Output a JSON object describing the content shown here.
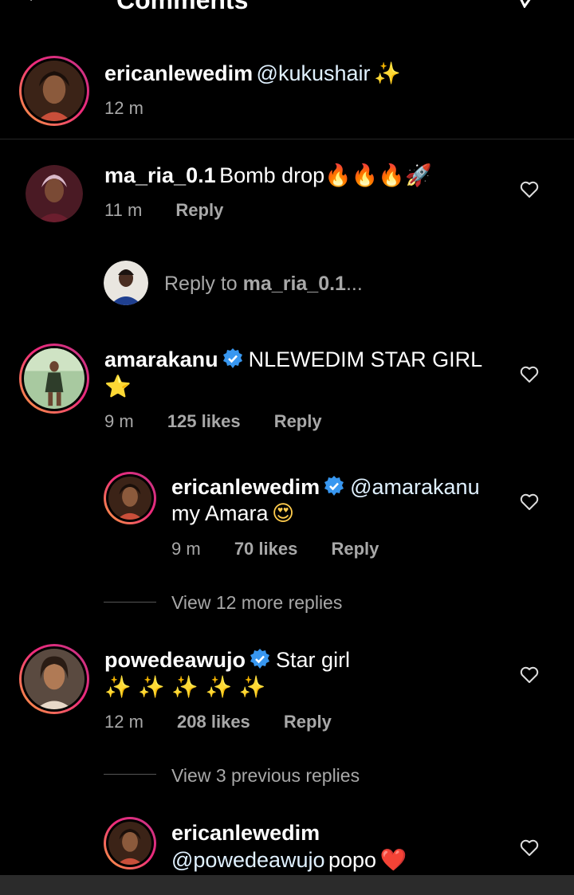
{
  "header": {
    "title": "Comments"
  },
  "caption": {
    "username": "ericanlewedim",
    "mention": "@kukushair",
    "emoji": "✨",
    "time": "12 m"
  },
  "comments": [
    {
      "username": "ma_ria_0.1",
      "text": "Bomb drop",
      "emojis": "🔥🔥🔥🚀",
      "time": "11 m",
      "reply_label": "Reply"
    },
    {
      "username": "amarakanu",
      "verified": true,
      "text": "NLEWEDIM STAR GIRL",
      "emojis": "⭐",
      "time": "9 m",
      "likes": "125 likes",
      "reply_label": "Reply"
    },
    {
      "username": "powedeawujo",
      "verified": true,
      "text": "Star girl",
      "emojis": "✨ ✨ ✨ ✨ ✨",
      "time": "12 m",
      "likes": "208 likes",
      "reply_label": "Reply"
    }
  ],
  "reply_box": {
    "prefix": "Reply to ",
    "target": "ma_ria_0.1",
    "suffix": "..."
  },
  "replies": [
    {
      "username": "ericanlewedim",
      "verified": true,
      "mention": "@amarakanu",
      "text": "my Amara",
      "emoji": "😍",
      "time": "9 m",
      "likes": "70 likes",
      "reply_label": "Reply"
    },
    {
      "username": "ericanlewedim",
      "mention": "@powedeawujo",
      "text": "popo",
      "emoji": "❤️"
    }
  ],
  "view_more": [
    "View 12 more replies",
    "View 3 previous replies"
  ],
  "colors": {
    "background": "#000000",
    "verified": "#3897f0",
    "meta": "#a8a8a8"
  }
}
